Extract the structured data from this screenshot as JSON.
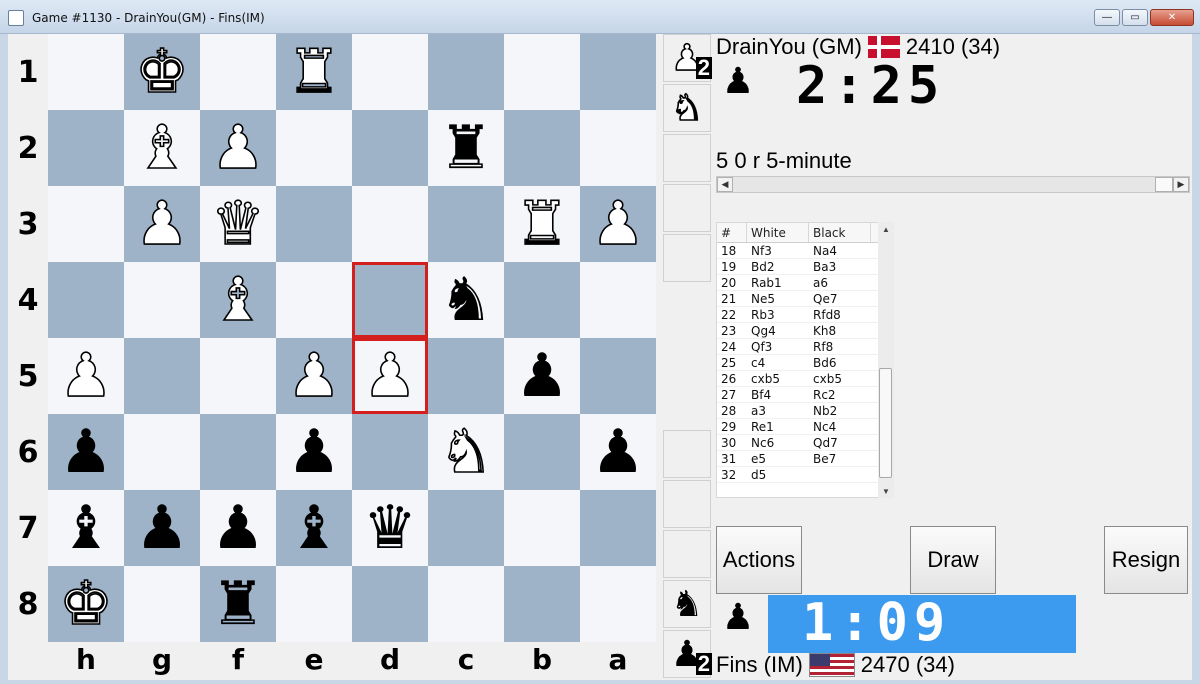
{
  "window": {
    "title": "Game #1130 - DrainYou(GM) - Fins(IM)",
    "minimize": "—",
    "maximize": "▭",
    "close": "✕"
  },
  "board": {
    "ranks": [
      "1",
      "2",
      "3",
      "4",
      "5",
      "6",
      "7",
      "8"
    ],
    "files": [
      "h",
      "g",
      "f",
      "e",
      "d",
      "c",
      "b",
      "a"
    ],
    "pieces": [
      {
        "rank": 0,
        "file": 1,
        "glyph": "♚",
        "color": "w",
        "name": "white-king-icon"
      },
      {
        "rank": 0,
        "file": 3,
        "glyph": "♜",
        "color": "w",
        "name": "white-rook-icon"
      },
      {
        "rank": 1,
        "file": 1,
        "glyph": "♝",
        "color": "w",
        "name": "white-bishop-icon"
      },
      {
        "rank": 1,
        "file": 2,
        "glyph": "♟",
        "color": "w",
        "name": "white-pawn-icon"
      },
      {
        "rank": 1,
        "file": 5,
        "glyph": "♜",
        "color": "b",
        "name": "black-rook-icon"
      },
      {
        "rank": 2,
        "file": 1,
        "glyph": "♟",
        "color": "w",
        "name": "white-pawn-icon"
      },
      {
        "rank": 2,
        "file": 2,
        "glyph": "♛",
        "color": "w",
        "name": "white-queen-icon"
      },
      {
        "rank": 2,
        "file": 6,
        "glyph": "♜",
        "color": "w",
        "name": "white-rook-icon"
      },
      {
        "rank": 2,
        "file": 7,
        "glyph": "♟",
        "color": "w",
        "name": "white-pawn-icon"
      },
      {
        "rank": 3,
        "file": 2,
        "glyph": "♝",
        "color": "w",
        "name": "white-bishop-icon"
      },
      {
        "rank": 3,
        "file": 5,
        "glyph": "♞",
        "color": "b",
        "name": "black-knight-icon"
      },
      {
        "rank": 4,
        "file": 0,
        "glyph": "♟",
        "color": "w",
        "name": "white-pawn-icon"
      },
      {
        "rank": 4,
        "file": 3,
        "glyph": "♟",
        "color": "w",
        "name": "white-pawn-icon"
      },
      {
        "rank": 4,
        "file": 4,
        "glyph": "♟",
        "color": "w",
        "name": "white-pawn-icon"
      },
      {
        "rank": 4,
        "file": 6,
        "glyph": "♟",
        "color": "b",
        "name": "black-pawn-icon"
      },
      {
        "rank": 5,
        "file": 0,
        "glyph": "♟",
        "color": "b",
        "name": "black-pawn-icon"
      },
      {
        "rank": 5,
        "file": 3,
        "glyph": "♟",
        "color": "b",
        "name": "black-pawn-icon"
      },
      {
        "rank": 5,
        "file": 5,
        "glyph": "♞",
        "color": "w",
        "name": "white-knight-icon"
      },
      {
        "rank": 5,
        "file": 7,
        "glyph": "♟",
        "color": "b",
        "name": "black-pawn-icon"
      },
      {
        "rank": 6,
        "file": 0,
        "glyph": "♝",
        "color": "b",
        "name": "black-bishop-icon"
      },
      {
        "rank": 6,
        "file": 1,
        "glyph": "♟",
        "color": "b",
        "name": "black-pawn-icon"
      },
      {
        "rank": 6,
        "file": 2,
        "glyph": "♟",
        "color": "b",
        "name": "black-pawn-icon"
      },
      {
        "rank": 6,
        "file": 3,
        "glyph": "♝",
        "color": "b",
        "name": "black-bishop-icon"
      },
      {
        "rank": 6,
        "file": 4,
        "glyph": "♛",
        "color": "b",
        "name": "black-queen-icon"
      },
      {
        "rank": 7,
        "file": 0,
        "glyph": "♚",
        "color": "w",
        "name": "white-king-icon"
      },
      {
        "rank": 7,
        "file": 2,
        "glyph": "♜",
        "color": "b",
        "name": "black-rook-icon"
      }
    ],
    "highlighted": [
      {
        "rank": 3,
        "file": 4
      },
      {
        "rank": 4,
        "file": 4
      }
    ],
    "highlight_color": "#d3201f"
  },
  "captured": {
    "top": [
      {
        "glyph": "♟",
        "color": "w",
        "count": "2"
      },
      {
        "glyph": "♞",
        "color": "w",
        "count": ""
      }
    ],
    "bottom": [
      {
        "glyph": "♞",
        "color": "b",
        "count": ""
      },
      {
        "glyph": "♟",
        "color": "b",
        "count": "2"
      }
    ]
  },
  "top_player": {
    "name": "DrainYou (GM)",
    "rating": "2410 (34)",
    "clock": "2:25"
  },
  "bottom_player": {
    "name": "Fins (IM)",
    "rating": "2470 (34)",
    "clock": "1:09",
    "clock_bg": "#3d9bef"
  },
  "game_info": "5 0 r 5-minute",
  "moves": {
    "headers": [
      "#",
      "White",
      "Black"
    ],
    "rows": [
      [
        "18",
        "Nf3",
        "Na4"
      ],
      [
        "19",
        "Bd2",
        "Ba3"
      ],
      [
        "20",
        "Rab1",
        "a6"
      ],
      [
        "21",
        "Ne5",
        "Qe7"
      ],
      [
        "22",
        "Rb3",
        "Rfd8"
      ],
      [
        "23",
        "Qg4",
        "Kh8"
      ],
      [
        "24",
        "Qf3",
        "Rf8"
      ],
      [
        "25",
        "c4",
        "Bd6"
      ],
      [
        "26",
        "cxb5",
        "cxb5"
      ],
      [
        "27",
        "Bf4",
        "Rc2"
      ],
      [
        "28",
        "a3",
        "Nb2"
      ],
      [
        "29",
        "Re1",
        "Nc4"
      ],
      [
        "30",
        "Nc6",
        "Qd7"
      ],
      [
        "31",
        "e5",
        "Be7"
      ],
      [
        "32",
        "d5",
        ""
      ]
    ]
  },
  "buttons": {
    "actions": "Actions",
    "draw": "Draw",
    "resign": "Resign"
  },
  "icons": {
    "avatar": "♟",
    "left_arrow": "◀",
    "right_arrow": "▶",
    "up_arrow": "▲",
    "down_arrow": "▼"
  }
}
